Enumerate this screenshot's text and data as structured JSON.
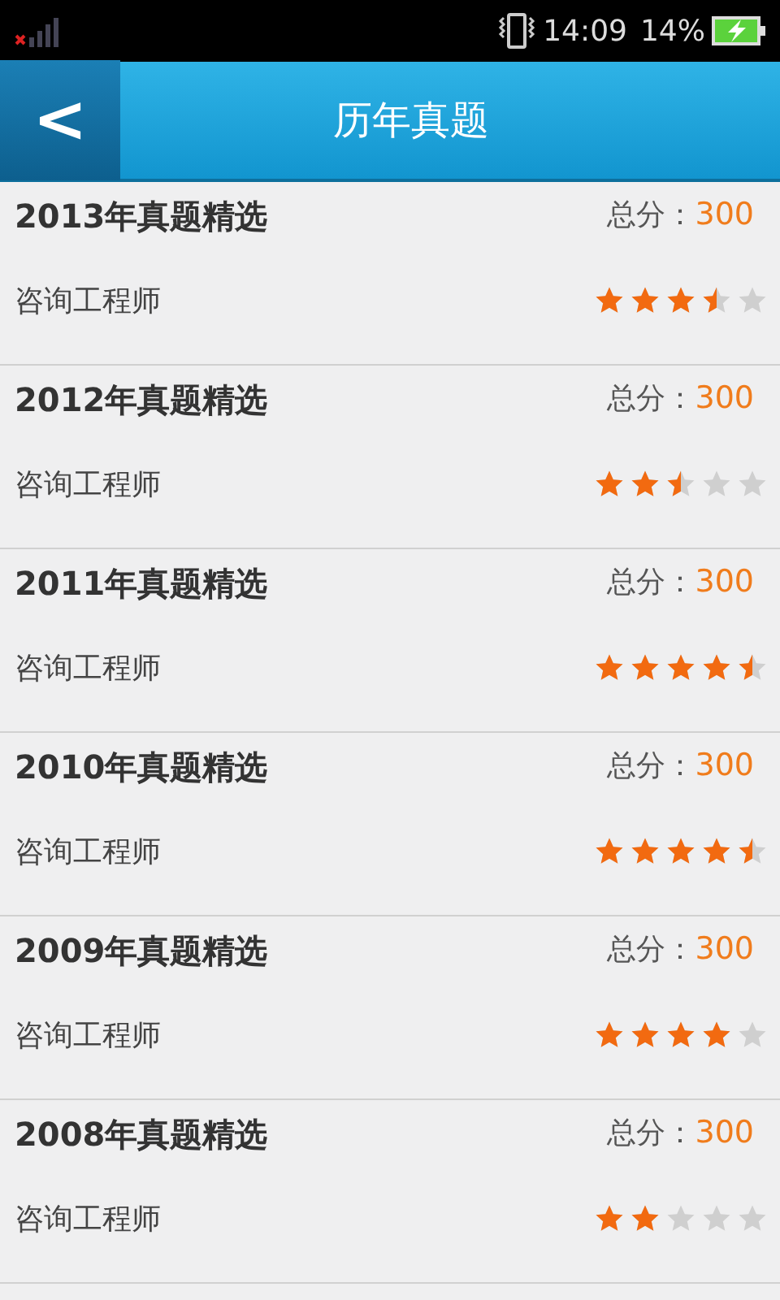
{
  "status_bar": {
    "time": "14:09",
    "battery": "14%"
  },
  "header": {
    "back": "<",
    "title": "历年真题"
  },
  "papers": [
    {
      "title": "2013年真题精选",
      "score_label": "总分：",
      "score": "300",
      "subject": "咨询工程师",
      "stars": 3.5
    },
    {
      "title": "2012年真题精选",
      "score_label": "总分：",
      "score": "300",
      "subject": "咨询工程师",
      "stars": 2.5
    },
    {
      "title": "2011年真题精选",
      "score_label": "总分：",
      "score": "300",
      "subject": "咨询工程师",
      "stars": 4.5
    },
    {
      "title": "2010年真题精选",
      "score_label": "总分：",
      "score": "300",
      "subject": "咨询工程师",
      "stars": 4.5
    },
    {
      "title": "2009年真题精选",
      "score_label": "总分：",
      "score": "300",
      "subject": "咨询工程师",
      "stars": 4
    },
    {
      "title": "2008年真题精选",
      "score_label": "总分：",
      "score": "300",
      "subject": "咨询工程师",
      "stars": 2
    }
  ]
}
